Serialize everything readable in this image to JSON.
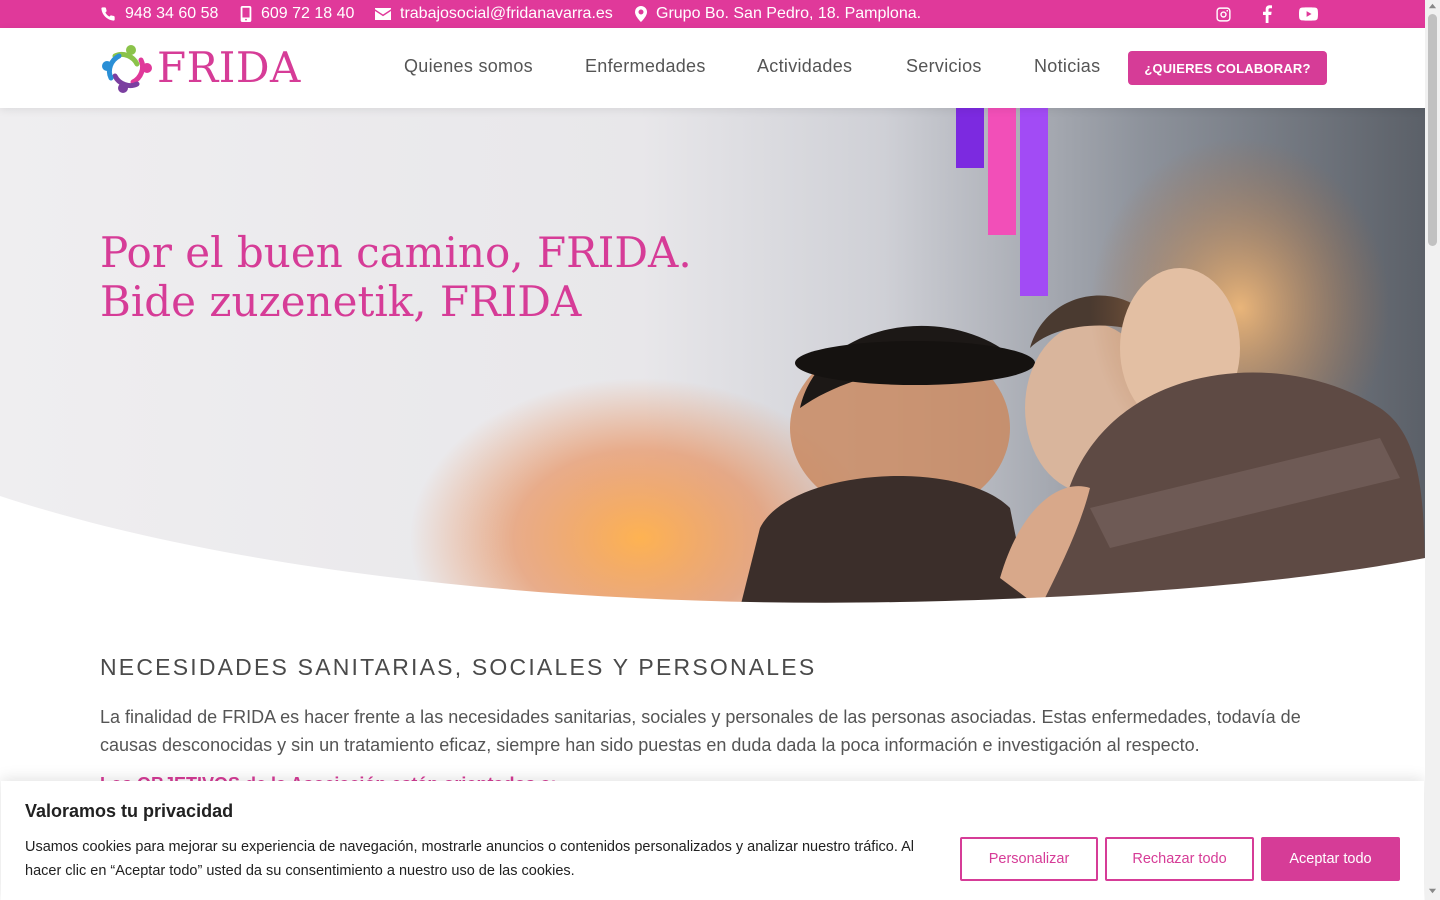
{
  "topbar": {
    "phone": "948 34 60 58",
    "mobile": "609 72 18 40",
    "email": "trabajosocial@fridanavarra.es",
    "address": "Grupo Bo. San Pedro, 18. Pamplona.",
    "icons": [
      "phone-icon",
      "mobile-icon",
      "envelope-icon",
      "map-pin-icon",
      "instagram-icon",
      "facebook-icon",
      "youtube-icon"
    ]
  },
  "header": {
    "logo_text": "FRIDA",
    "nav": [
      "Quienes somos",
      "Enfermedades",
      "Actividades",
      "Servicios",
      "Noticias"
    ],
    "cta_label": "¿QUIERES COLABORAR?"
  },
  "hero": {
    "title_line1": "Por el buen camino, FRIDA.",
    "title_line2": "Bide zuzenetik, FRIDA"
  },
  "content": {
    "heading": "NECESIDADES SANITARIAS, SOCIALES Y PERSONALES",
    "paragraph": "La finalidad de FRIDA es hacer frente a las necesidades sanitarias, sociales y personales de las personas asociadas. Estas enfermedades, todavía de causas desconocidas y sin un tratamiento eficaz, siempre han sido puestas en duda dada la poca información e investigación al respecto.",
    "link": "Los OBJETIVOS de la Asociación están orientados a:"
  },
  "cookie": {
    "title": "Valoramos tu privacidad",
    "text": "Usamos cookies para mejorar su experiencia de navegación, mostrarle anuncios o contenidos personalizados y analizar nuestro tráfico. Al hacer clic en “Aceptar todo” usted da su consentimiento a nuestro uso de las cookies.",
    "customize": "Personalizar",
    "reject": "Rechazar todo",
    "accept": "Aceptar todo"
  },
  "colors": {
    "brand_pink": "#d63c97",
    "topbar_pink": "#e0399a",
    "accent_purple": "#7c2ae0",
    "accent_violet": "#a24bf5",
    "accent_magenta": "#f24fb8"
  }
}
